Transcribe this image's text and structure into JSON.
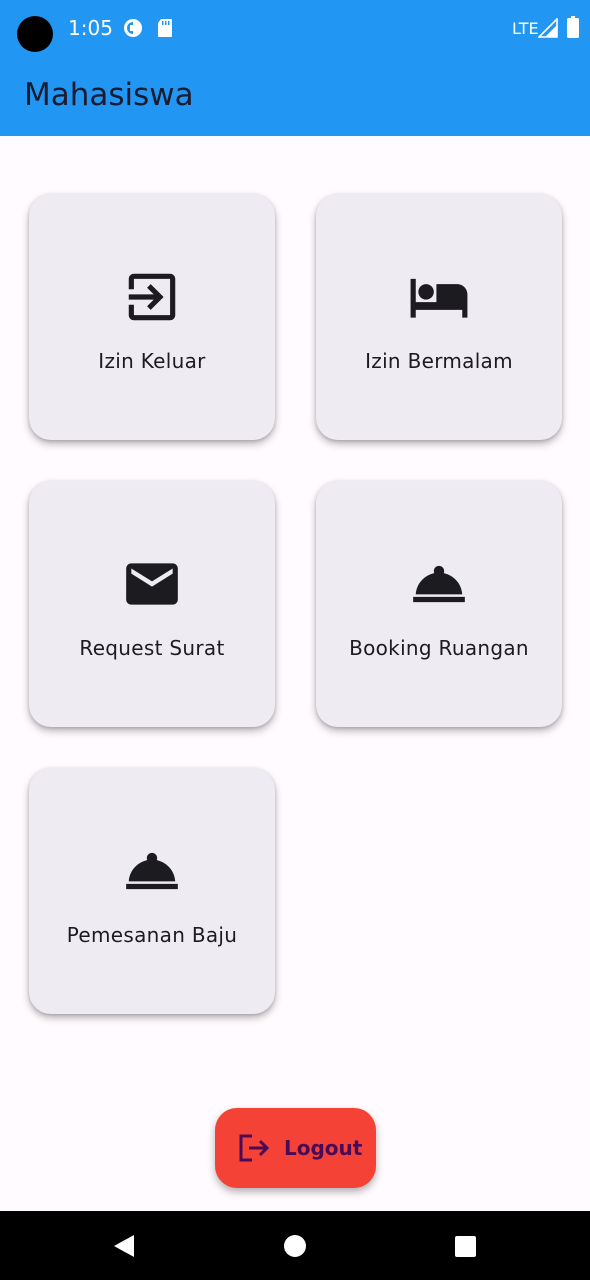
{
  "status_bar": {
    "time": "1:05",
    "network": "LTE",
    "icons": [
      "camera-cutout-icon",
      "app-notification-icon",
      "sd-card-icon",
      "signal-icon",
      "battery-icon"
    ]
  },
  "app_bar": {
    "title": "Mahasiswa",
    "background_color": "#2196f3"
  },
  "menu": {
    "items": [
      {
        "label": "Izin Keluar",
        "icon": "exit-to-app-icon"
      },
      {
        "label": "Izin Bermalam",
        "icon": "hotel-bed-icon"
      },
      {
        "label": "Request Surat",
        "icon": "mail-icon"
      },
      {
        "label": "Booking Ruangan",
        "icon": "room-service-icon"
      },
      {
        "label": "Pemesanan Baju",
        "icon": "room-service-icon"
      }
    ]
  },
  "logout": {
    "label": "Logout",
    "icon": "logout-icon",
    "background_color": "#f44336"
  },
  "nav_bar": {
    "icons": [
      "back-icon",
      "home-icon",
      "recents-icon"
    ]
  }
}
